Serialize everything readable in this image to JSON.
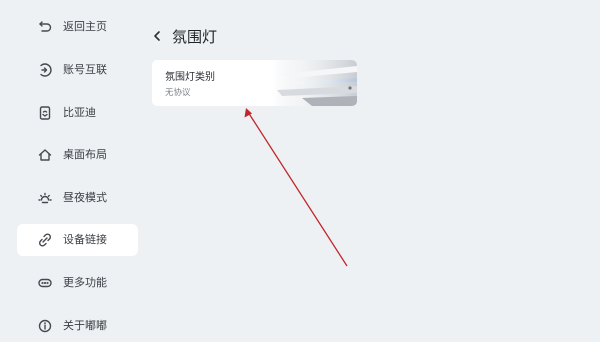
{
  "sidebar": {
    "items": [
      {
        "label": "返回主页",
        "icon": "back-return-icon"
      },
      {
        "label": "账号互联",
        "icon": "account-link-icon"
      },
      {
        "label": "比亚迪",
        "icon": "phone-icon"
      },
      {
        "label": "桌面布局",
        "icon": "home-icon"
      },
      {
        "label": "昼夜模式",
        "icon": "day-night-icon"
      },
      {
        "label": "设备链接",
        "icon": "link-icon",
        "active": true
      },
      {
        "label": "更多功能",
        "icon": "more-icon"
      },
      {
        "label": "关于嘟嘟",
        "icon": "info-icon"
      }
    ]
  },
  "header": {
    "title": "氛围灯"
  },
  "card": {
    "title": "氛围灯类别",
    "subtitle": "无协议"
  },
  "colors": {
    "background": "#eef1f3",
    "annotation_arrow": "#c0262c"
  }
}
